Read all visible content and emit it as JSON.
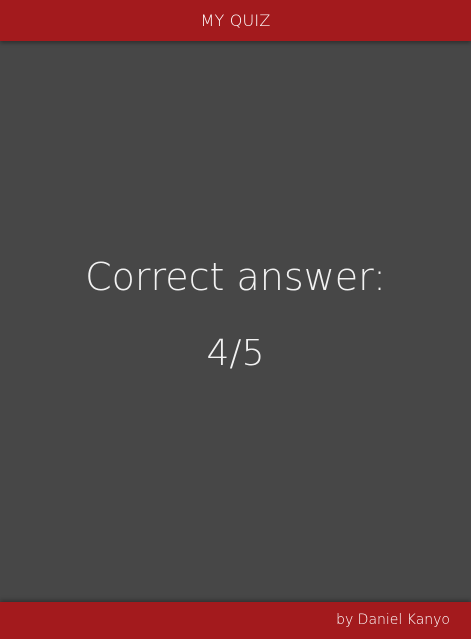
{
  "header": {
    "title": "MY QUIZ"
  },
  "result": {
    "label": "Correct answer:",
    "score": "4/5"
  },
  "footer": {
    "credit": "by Daniel Kanyo"
  },
  "colors": {
    "bar": "#a31a1d",
    "background": "#474747",
    "text": "#ffffff"
  }
}
